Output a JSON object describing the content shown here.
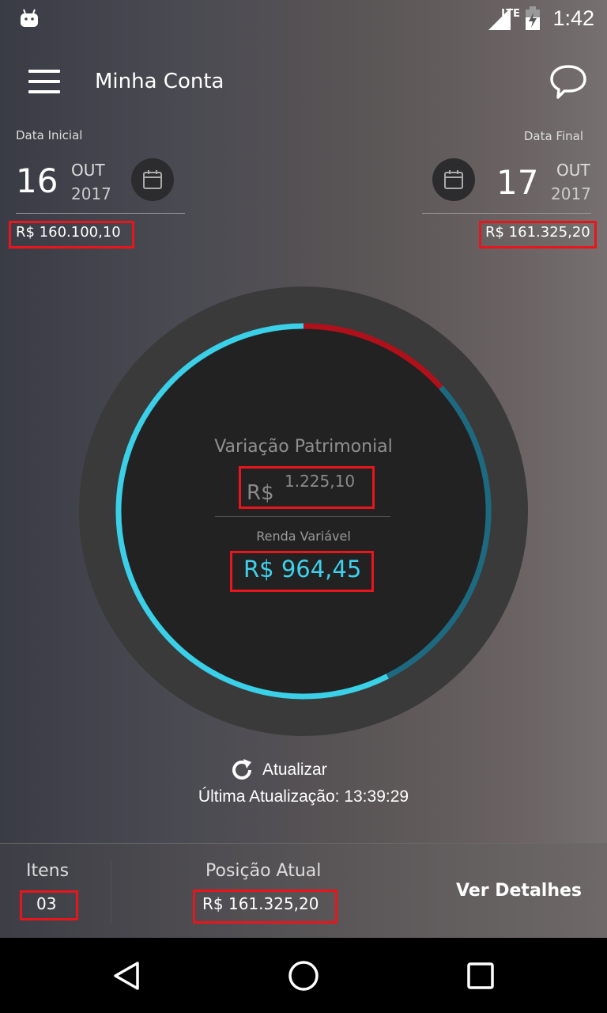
{
  "status_bar": {
    "network": "LTE",
    "time": "1:42"
  },
  "header": {
    "title": "Minha Conta"
  },
  "start": {
    "label": "Data Inicial",
    "day": "16",
    "month": "OUT",
    "year": "2017",
    "amount": "R$ 160.100,10"
  },
  "end": {
    "label": "Data Final",
    "day": "17",
    "month": "OUT",
    "year": "2017",
    "amount": "R$ 161.325,20"
  },
  "gauge": {
    "title": "Variação Patrimonial",
    "currency": "R$",
    "variation": "1.225,10",
    "subtitle": "Renda Variável",
    "value": "R$ 964,45",
    "colors": {
      "cyan": "#3ad0e8",
      "dark_teal": "#1d6a80",
      "red": "#b0101a"
    }
  },
  "refresh": {
    "label": "Atualizar",
    "last_update": "Última Atualização: 13:39:29"
  },
  "footer": {
    "items_label": "Itens",
    "items_value": "03",
    "position_label": "Posição Atual",
    "position_value": "R$ 161.325,20",
    "details_label": "Ver Detalhes"
  },
  "icons": [
    "android-icon",
    "lte-signal-icon",
    "battery-icon",
    "menu-icon",
    "chat-icon",
    "calendar-icon",
    "refresh-icon",
    "back-icon",
    "home-icon",
    "recents-icon"
  ]
}
